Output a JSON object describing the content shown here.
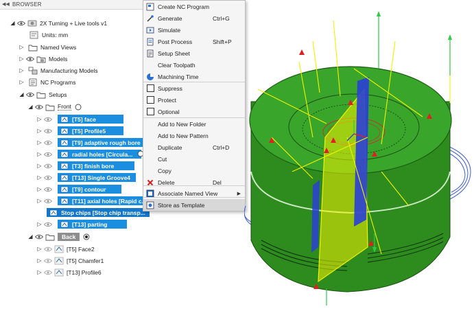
{
  "browser": {
    "title": "BROWSER",
    "document": "2X Turning + Live tools v1",
    "units": "Units: mm",
    "named_views": "Named Views",
    "models": "Models",
    "manufacturing_models": "Manufacturing Models",
    "nc_programs": "NC Programs",
    "setups": "Setups",
    "front": "Front",
    "front_ops": [
      "[T5] face",
      "[T5] Profile5",
      "[T9] adaptive rough bore",
      "radial holes [Circula...",
      "[T3] finish bore",
      "[T13] Single Groove4",
      "[T9] contour",
      "[T11] axial holes [Rapid c...",
      "Stop chips [Stop chip transp...",
      "[T13] parting"
    ],
    "back": "Back",
    "back_ops": [
      "[T5] Face2",
      "[T5] Chamfer1",
      "[T13] Profile6"
    ]
  },
  "context_menu": {
    "items": [
      {
        "label": "Create NC Program",
        "shortcut": ""
      },
      {
        "label": "Generate",
        "shortcut": "Ctrl+G"
      },
      {
        "label": "Simulate",
        "shortcut": ""
      },
      {
        "label": "Post Process",
        "shortcut": "Shift+P"
      },
      {
        "label": "Setup Sheet",
        "shortcut": ""
      },
      {
        "label": "Clear Toolpath",
        "shortcut": ""
      },
      {
        "label": "Machining Time",
        "shortcut": ""
      },
      {
        "label": "Suppress",
        "shortcut": ""
      },
      {
        "label": "Protect",
        "shortcut": ""
      },
      {
        "label": "Optional",
        "shortcut": ""
      },
      {
        "label": "Add to New Folder",
        "shortcut": ""
      },
      {
        "label": "Add to New Pattern",
        "shortcut": ""
      },
      {
        "label": "Duplicate",
        "shortcut": "Ctrl+D"
      },
      {
        "label": "Cut",
        "shortcut": ""
      },
      {
        "label": "Copy",
        "shortcut": ""
      },
      {
        "label": "Delete",
        "shortcut": "Del"
      },
      {
        "label": "Associate Named View",
        "shortcut": ""
      },
      {
        "label": "Store as Template",
        "shortcut": ""
      }
    ]
  },
  "colors": {
    "selection": "#1b8ee0",
    "part_green": "#2e8b1e",
    "toolpath_yellow": "#f2f200",
    "bar_blue": "#2a3fd6"
  }
}
